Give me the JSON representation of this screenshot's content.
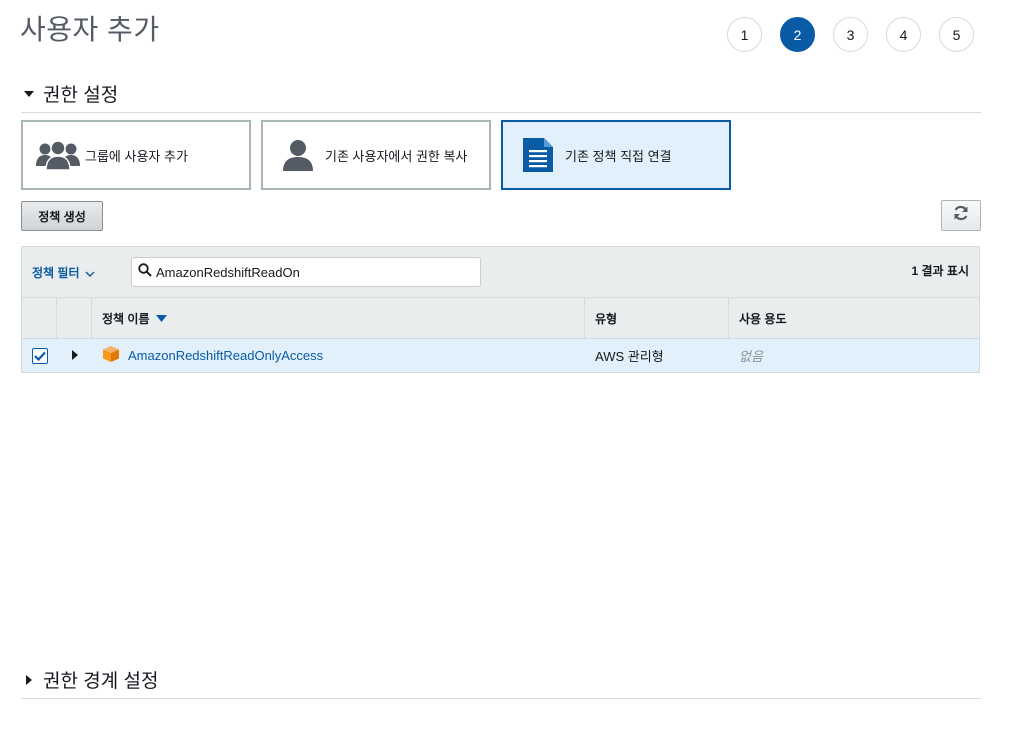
{
  "page": {
    "title": "사용자 추가"
  },
  "steps": [
    {
      "label": "1",
      "active": false
    },
    {
      "label": "2",
      "active": true
    },
    {
      "label": "3",
      "active": false
    },
    {
      "label": "4",
      "active": false
    },
    {
      "label": "5",
      "active": false
    }
  ],
  "permissions_section": {
    "label": "권한 설정",
    "expanded": true
  },
  "options": [
    {
      "label": "그룹에 사용자 추가",
      "icon": "users-group-icon",
      "selected": false
    },
    {
      "label": "기존 사용자에서 권한 복사",
      "icon": "user-icon",
      "selected": false
    },
    {
      "label": "기존 정책 직접 연결",
      "icon": "document-icon",
      "selected": true
    }
  ],
  "toolbar": {
    "create_policy_label": "정책 생성",
    "refresh_icon": "refresh-icon"
  },
  "filter": {
    "dropdown_label": "정책 필터",
    "search_value": "AmazonRedshiftReadOn",
    "result_count": "1 결과 표시"
  },
  "table": {
    "columns": {
      "name": "정책 이름",
      "type": "유형",
      "usage": "사용 용도"
    },
    "rows": [
      {
        "checked": true,
        "name": "AmazonRedshiftReadOnlyAccess",
        "type": "AWS 관리형",
        "usage": "없음"
      }
    ]
  },
  "boundary_section": {
    "label": "권한 경계 설정",
    "expanded": false
  },
  "colors": {
    "accent": "#0a5ba6",
    "selected_bg": "#e1f0fb",
    "aws_orange": "#f7981d"
  }
}
